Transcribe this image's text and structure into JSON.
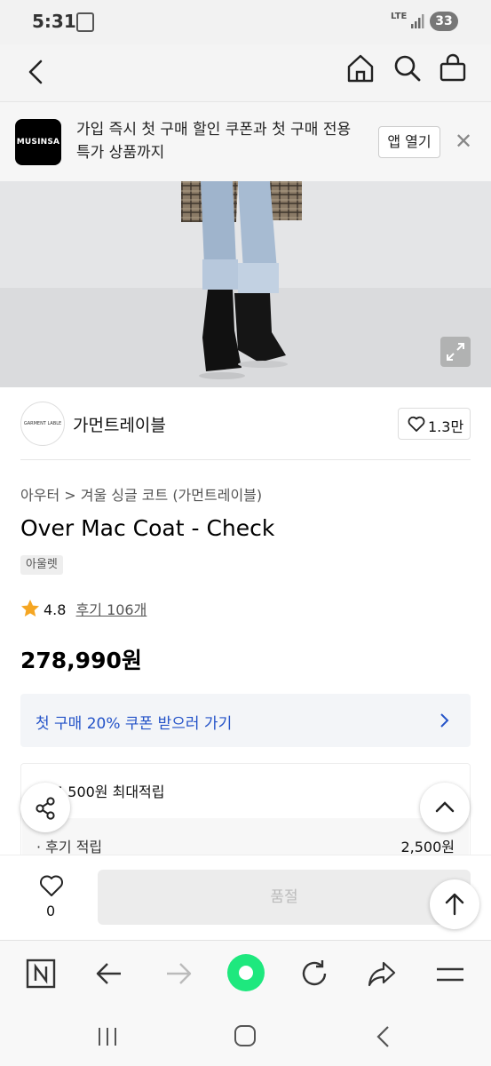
{
  "status_bar": {
    "time": "5:31",
    "network": "LTE",
    "battery": "33"
  },
  "app_banner": {
    "logo_text": "MUSINSA",
    "message": "가입 즉시 첫 구매 할인 쿠폰과 첫 구매 전용 특가 상품까지",
    "open_app_label": "앱 열기",
    "close_label": "✕"
  },
  "brand": {
    "logo_text": "GARMENT LABLE",
    "name": "가먼트레이블",
    "likes": "1.3만"
  },
  "product": {
    "breadcrumb": "아우터 > 겨울 싱글 코트 (가먼트레이블)",
    "title": "Over Mac Coat - Check",
    "badge": "아울렛",
    "rating": "4.8",
    "review_label": "후기 106개",
    "price": "278,990원"
  },
  "coupon_banner": {
    "label": "첫 구매 20% 쿠폰 받으러 가기"
  },
  "points": {
    "header": "5,500원 최대적립",
    "rows": [
      {
        "label": "· 후기 적립",
        "value": "2,500원"
      }
    ]
  },
  "purchase_bar": {
    "like_count": "0",
    "soldout_label": "품절"
  },
  "colors": {
    "coupon_text": "#2453c8",
    "browser_accent": "#1ee87e"
  }
}
